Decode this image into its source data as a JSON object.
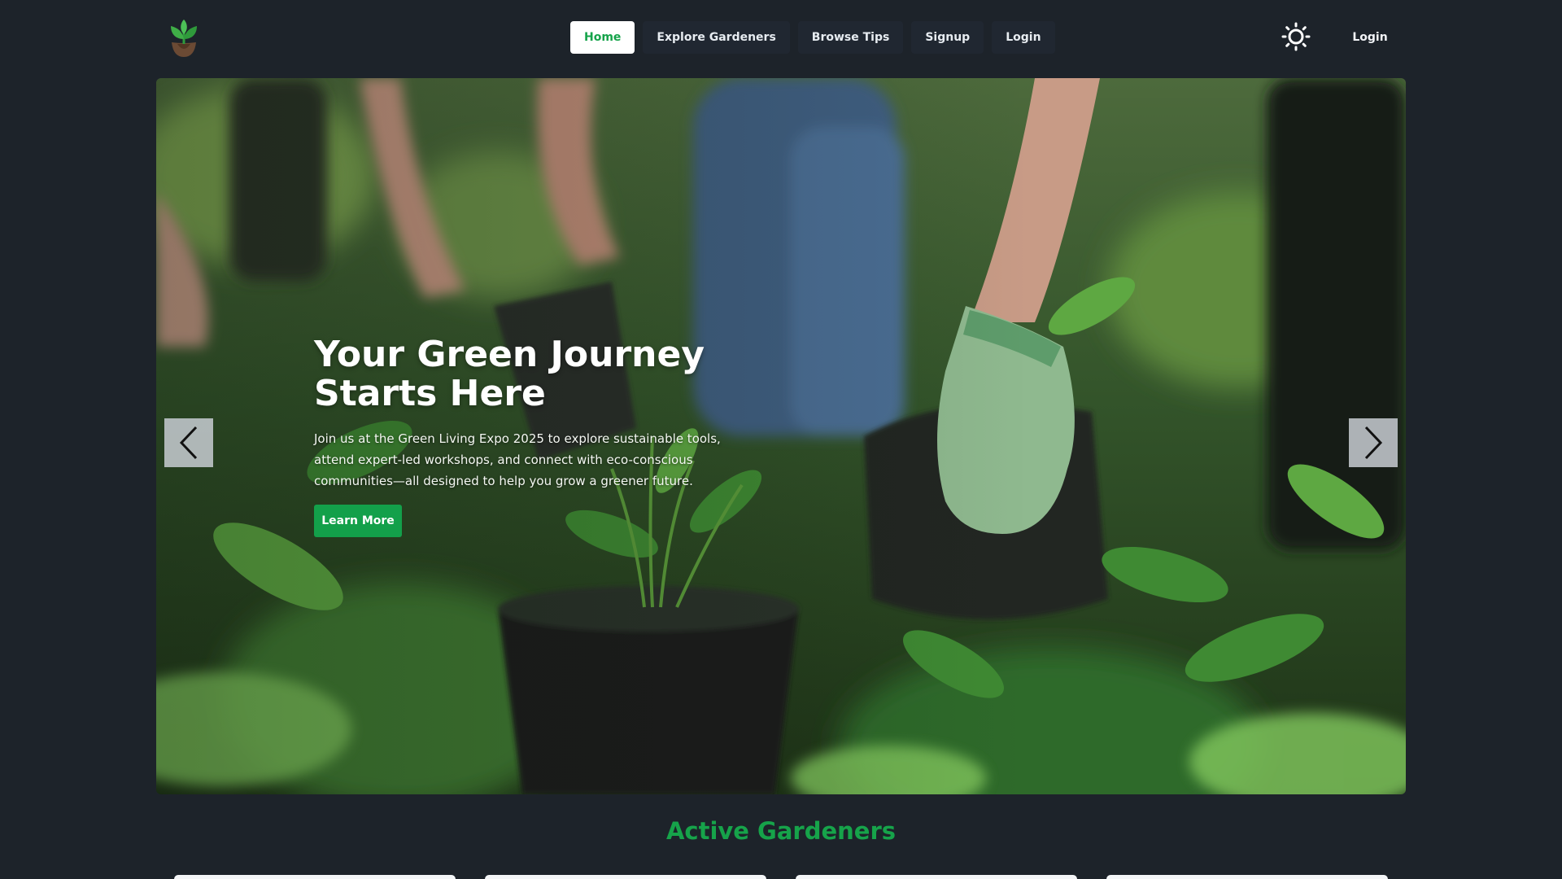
{
  "nav": {
    "logo_icon": "sprout-in-pot-icon",
    "items": [
      {
        "label": "Home",
        "active": true
      },
      {
        "label": "Explore Gardeners",
        "active": false
      },
      {
        "label": "Browse Tips",
        "active": false
      },
      {
        "label": "Signup",
        "active": false
      },
      {
        "label": "Login",
        "active": false
      }
    ],
    "theme_icon": "sun-icon",
    "login_label": "Login"
  },
  "hero": {
    "title": "Your Green Journey Starts Here",
    "description": "Join us at the Green Living Expo 2025 to explore sustainable tools, attend expert-led workshops, and connect with eco-conscious communities—all designed to help you grow a greener future.",
    "cta_label": "Learn More",
    "prev_icon": "chevron-left-icon",
    "next_icon": "chevron-right-icon"
  },
  "section": {
    "title": "Active Gardeners"
  },
  "colors": {
    "background": "#1d232a",
    "accent": "#16a34a",
    "button_green": "#13a04a"
  }
}
